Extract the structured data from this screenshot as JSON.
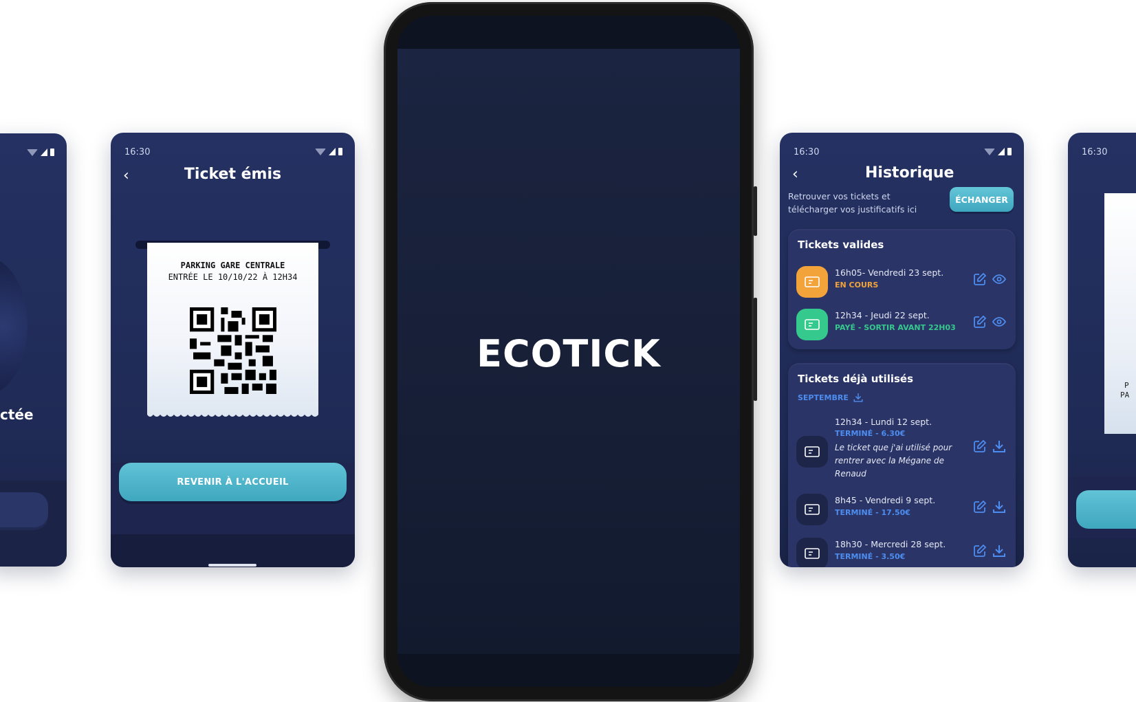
{
  "app_name": "ECOTICK",
  "status_time": "16:30",
  "left_partial": {
    "text": "ctée"
  },
  "ticket_screen": {
    "title": "Ticket émis",
    "receipt_line1": "PARKING GARE CENTRALE",
    "receipt_line2": "ENTRÉE LE 10/10/22 À 12H34",
    "button": "REVENIR À L'ACCUEIL"
  },
  "history_screen": {
    "title": "Historique",
    "subtitle": "Retrouver vos tickets et télécharger vos justificatifs ici",
    "exchange_button": "ÉCHANGER",
    "valid_section": {
      "title": "Tickets valides",
      "items": [
        {
          "line1": "16h05- Vendredi 23 sept.",
          "status": "EN COURS",
          "color": "#f2a33a",
          "status_color": "#f2a33a"
        },
        {
          "line1": "12h34 - Jeudi 22 sept.",
          "status": "PAYÉ - SORTIR AVANT 22H03",
          "color": "#35c98d",
          "status_color": "#35c98d"
        }
      ]
    },
    "used_section": {
      "title": "Tickets déjà utilisés",
      "month": "SEPTEMBRE",
      "items": [
        {
          "line1": "12h34 - Lundi 12 sept.",
          "status": "TERMINÉ - 6.30€",
          "note": "Le ticket que j'ai utilisé pour rentrer avec la Mégane de Renaud"
        },
        {
          "line1": "8h45 - Vendredi 9 sept.",
          "status": "TERMINÉ - 17.50€"
        },
        {
          "line1": "18h30 - Mercredi 28 sept.",
          "status": "TERMINÉ - 3.50€"
        }
      ]
    }
  },
  "right_partial": {
    "time": "16:30",
    "receipt_line1": "P",
    "receipt_line2": "PA"
  },
  "colors": {
    "accent_cyan": "#4fb6cc",
    "link_blue": "#4e8df0",
    "background_navy": "#243162"
  },
  "icons": [
    "back-chevron-icon",
    "ticket-icon",
    "edit-icon",
    "eye-icon",
    "download-icon",
    "qr-code-icon"
  ]
}
